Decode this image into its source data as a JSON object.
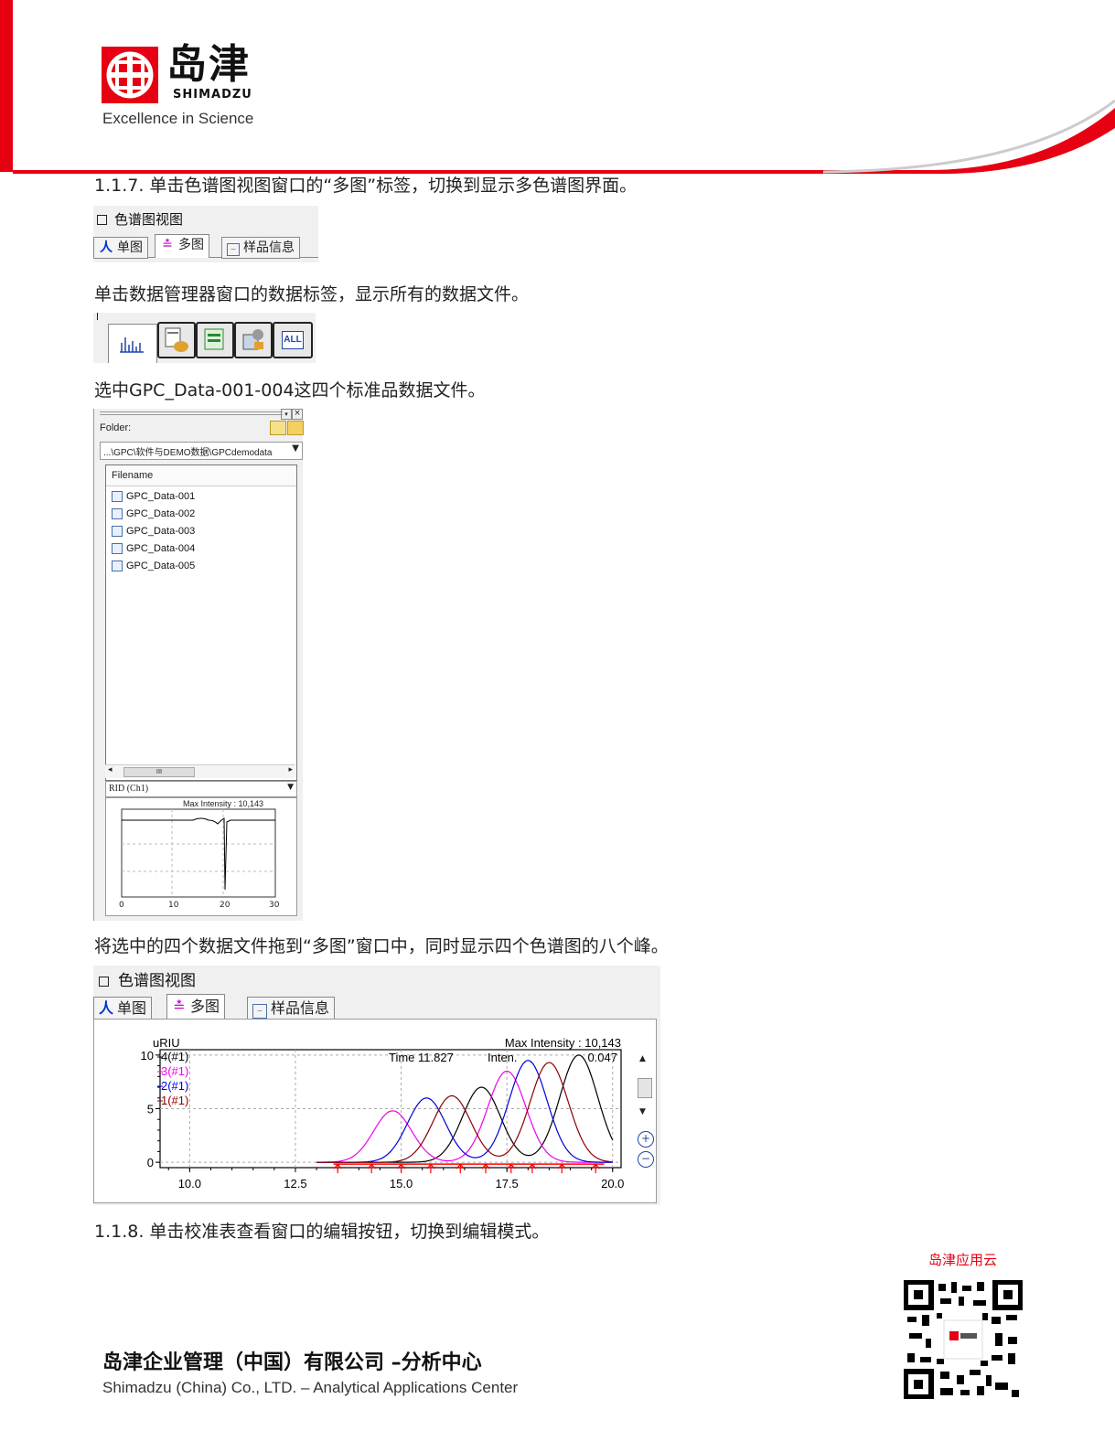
{
  "header": {
    "logo_cn": "岛津",
    "logo_en": "SHIMADZU",
    "tagline": "Excellence in Science"
  },
  "step_1_1_7": {
    "text": "1.1.7. 单击色谱图视图窗口的“多图”标签，切换到显示多色谱图界面。"
  },
  "chrom_view_small": {
    "title": "色谱图视图",
    "tabs": [
      "单图",
      "多图",
      "样品信息"
    ],
    "selected_tab": 1
  },
  "para_data_tab": {
    "text": "单击数据管理器窗口的数据标签，显示所有的数据文件。"
  },
  "data_manager_tabs": {
    "icons": [
      "data-tab-icon",
      "method-tab-icon",
      "report-tab-icon",
      "batch-tab-icon",
      "all-tab-icon"
    ],
    "all_label": "ALL"
  },
  "para_select": {
    "text": "选中GPC_Data-001-004这四个标准品数据文件。"
  },
  "file_panel": {
    "folder_label": "Folder:",
    "folder_path": "...\\GPC\\软件与DEMO数据\\GPCdemodata",
    "column_header": "Filename",
    "files": [
      "GPC_Data-001",
      "GPC_Data-002",
      "GPC_Data-003",
      "GPC_Data-004",
      "GPC_Data-005"
    ],
    "scroll_mark": "III",
    "channel": "RID (Ch1)",
    "preview_max": "Max Intensity :  10,143",
    "preview_ticks": [
      "0",
      "10",
      "20",
      "30"
    ]
  },
  "para_drag": {
    "text": "将选中的四个数据文件拖到“多图”窗口中，同时显示四个色谱图的八个峰。"
  },
  "chrom_view_large": {
    "title": "色谱图视图",
    "tabs": [
      "单图",
      "多图",
      "样品信息"
    ],
    "selected_tab": 1
  },
  "chart_data": {
    "type": "line",
    "ylabel": "uRIU",
    "max_intensity": "Max Intensity :  10,143",
    "cursor_time": "Time   11.827",
    "cursor_inten": "Inten.",
    "cursor_value": "0.047",
    "xlim": [
      9.3,
      20.2
    ],
    "ylim": [
      -0.5,
      10.5
    ],
    "x_ticks": [
      "10.0",
      "12.5",
      "15.0",
      "17.5",
      "20.0"
    ],
    "y_ticks": [
      "0",
      "5",
      "10"
    ],
    "grid": true,
    "legend_position": "top-left",
    "series": [
      {
        "name": "4(#1)",
        "color": "#000000",
        "peaks": [
          [
            16.9,
            7.0
          ],
          [
            19.2,
            10.0
          ]
        ]
      },
      {
        "name": "3(#1)",
        "color": "#ee00ee",
        "peaks": [
          [
            14.8,
            4.8
          ],
          [
            17.5,
            8.5
          ]
        ]
      },
      {
        "name": "2(#1)",
        "color": "#0000dd",
        "peaks": [
          [
            15.6,
            6.0
          ],
          [
            18.0,
            9.5
          ]
        ]
      },
      {
        "name": "1(#1)",
        "color": "#8b0000",
        "peaks": [
          [
            16.2,
            6.2
          ],
          [
            18.5,
            9.3
          ]
        ]
      }
    ],
    "markers_x": [
      13.5,
      14.3,
      15.0,
      15.7,
      16.4,
      17.0,
      17.6,
      18.1,
      18.8,
      19.6
    ]
  },
  "step_1_1_8": {
    "text": "1.1.8. 单击校准表查看窗口的编辑按钮，切换到编辑模式。"
  },
  "footer": {
    "qr_label": "岛津应用云",
    "company_cn": "岛津企业管理（中国）有限公司 –分析中心",
    "company_en": "Shimadzu (China) Co., LTD. – Analytical Applications Center"
  },
  "colors": {
    "brand_red": "#e60012"
  }
}
